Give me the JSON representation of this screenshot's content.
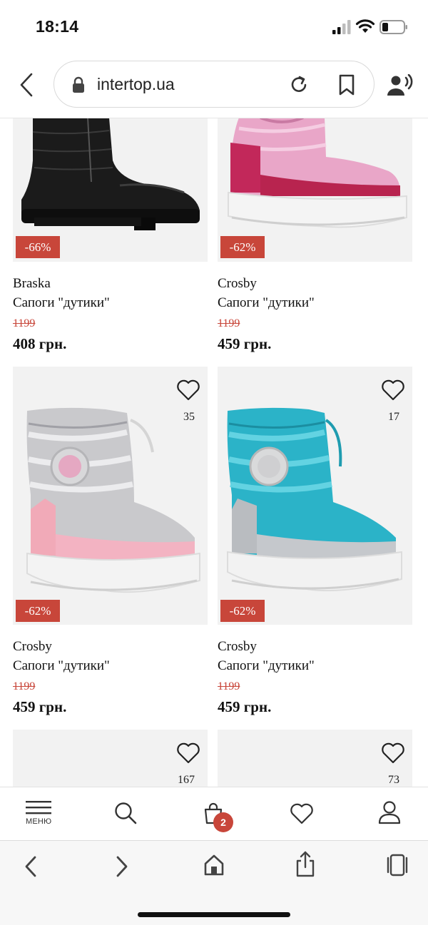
{
  "status_bar": {
    "time": "18:14"
  },
  "browser": {
    "url": "intertop.ua",
    "icons": [
      "chevron-left-icon",
      "lock-icon",
      "reload-icon",
      "bookmark-icon",
      "speaker-icon"
    ]
  },
  "products": [
    {
      "brand": "Braska",
      "name": "Сапоги \"дутики\"",
      "old_price": "1199",
      "price": "408 грн.",
      "discount": "-66%",
      "likes": "",
      "image_color": "black"
    },
    {
      "brand": "Crosby",
      "name": "Сапоги \"дутики\"",
      "old_price": "1199",
      "price": "459 грн.",
      "discount": "-62%",
      "likes": "",
      "image_color": "pink"
    },
    {
      "brand": "Crosby",
      "name": "Сапоги \"дутики\"",
      "old_price": "1199",
      "price": "459 грн.",
      "discount": "-62%",
      "likes": "35",
      "image_color": "silver-pink"
    },
    {
      "brand": "Crosby",
      "name": "Сапоги \"дутики\"",
      "old_price": "1199",
      "price": "459 грн.",
      "discount": "-62%",
      "likes": "17",
      "image_color": "turquoise"
    },
    {
      "likes": "167"
    },
    {
      "likes": "73"
    }
  ],
  "site_nav": {
    "menu_label": "МЕНЮ",
    "cart_count": "2",
    "icons": [
      "menu-icon",
      "search-icon",
      "bag-icon",
      "heart-icon",
      "user-icon"
    ]
  },
  "safari_toolbar": {
    "icons": [
      "back-icon",
      "forward-icon",
      "home-icon",
      "share-icon",
      "tabs-icon"
    ]
  },
  "colors": {
    "accent": "#c8463a",
    "card_bg": "#f2f2f2",
    "text": "#111111"
  }
}
